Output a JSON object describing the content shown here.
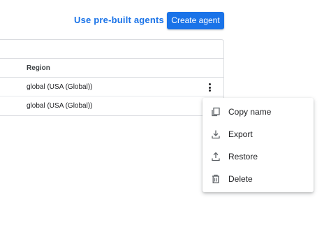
{
  "header": {
    "prebuilt_label": "Use pre-built agents",
    "create_label": "Create agent"
  },
  "table": {
    "columns": {
      "region": "Region"
    },
    "rows": [
      {
        "region": "global (USA (Global))"
      },
      {
        "region": "global (USA (Global))"
      }
    ]
  },
  "menu": {
    "items": [
      {
        "label": "Copy name",
        "icon": "copy-icon"
      },
      {
        "label": "Export",
        "icon": "download-icon"
      },
      {
        "label": "Restore",
        "icon": "upload-icon"
      },
      {
        "label": "Delete",
        "icon": "trash-icon"
      }
    ]
  },
  "colors": {
    "accent": "#1a73e8",
    "border": "#dadce0",
    "text": "#202124"
  }
}
